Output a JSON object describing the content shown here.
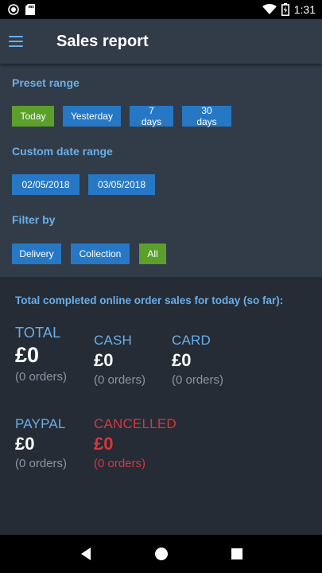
{
  "status_bar": {
    "time": "1:31"
  },
  "header": {
    "title": "Sales report"
  },
  "preset": {
    "label": "Preset range",
    "buttons": [
      "Today",
      "Yesterday",
      "7 days",
      "30 days"
    ],
    "active": "Today"
  },
  "custom": {
    "label": "Custom date range",
    "from": "02/05/2018",
    "to": "03/05/2018"
  },
  "filter": {
    "label": "Filter by",
    "buttons": [
      "Delivery",
      "Collection",
      "All"
    ],
    "active": "All"
  },
  "summary": {
    "title": "Total completed online order sales for today (so far):",
    "total": {
      "label": "TOTAL",
      "value": "£0",
      "orders": "(0 orders)"
    },
    "cash": {
      "label": "CASH",
      "value": "£0",
      "orders": "(0 orders)"
    },
    "card": {
      "label": "CARD",
      "value": "£0",
      "orders": "(0 orders)"
    },
    "paypal": {
      "label": "PAYPAL",
      "value": "£0",
      "orders": "(0 orders)"
    },
    "cancelled": {
      "label": "CANCELLED",
      "value": "£0",
      "orders": "(0 orders)"
    }
  },
  "colors": {
    "accent": "#6aaee8",
    "button": "#2678c4",
    "active_button": "#5ba02a",
    "cancelled": "#d9363e",
    "panel": "#323c48",
    "background": "#252c36"
  },
  "icons": {
    "status_left": [
      "notification-circle-icon",
      "sd-card-icon"
    ],
    "status_right": [
      "wifi-icon",
      "battery-charging-icon"
    ],
    "nav": [
      "back-icon",
      "home-icon",
      "recents-icon"
    ]
  }
}
